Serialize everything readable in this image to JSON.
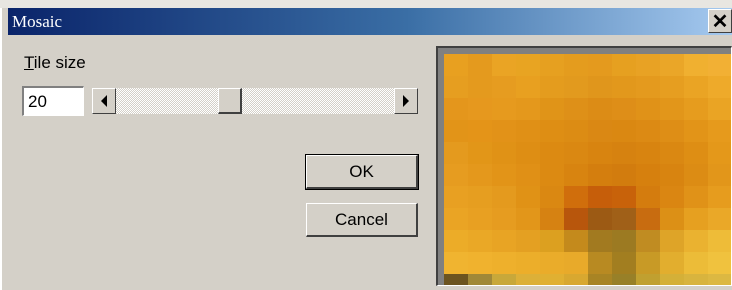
{
  "window": {
    "title": "Mosaic",
    "close_glyph": "✕"
  },
  "tile_size": {
    "label_mnemonic": "T",
    "label_rest": "ile size",
    "value": "20",
    "slider_fraction": 0.4
  },
  "buttons": {
    "ok": "OK",
    "cancel": "Cancel"
  },
  "preview": {
    "tiles": [
      [
        "#e8a020",
        "#e49a1e",
        "#eaa424",
        "#e8a422",
        "#e6a020",
        "#e49c1e",
        "#e49a1e",
        "#e6a020",
        "#e8a224",
        "#eaa628",
        "#f0b030",
        "#f2b034"
      ],
      [
        "#e69e20",
        "#e49a1e",
        "#e69c20",
        "#e8a020",
        "#e49c1e",
        "#e29a1e",
        "#e0961c",
        "#e2981c",
        "#e49a1e",
        "#e69e20",
        "#eaa424",
        "#eeaa2a"
      ],
      [
        "#e4961c",
        "#e6981e",
        "#e69a1e",
        "#e4981c",
        "#e09418",
        "#de9018",
        "#dc8c16",
        "#de8e18",
        "#e09218",
        "#e2961a",
        "#e69c1e",
        "#eaa424"
      ],
      [
        "#e29418",
        "#e49418",
        "#e29218",
        "#e09016",
        "#de8e14",
        "#dc8c14",
        "#da8814",
        "#da8812",
        "#dc8a14",
        "#de8e16",
        "#e29418",
        "#e69a1c"
      ],
      [
        "#e49a1e",
        "#e29618",
        "#e09216",
        "#de8e14",
        "#dc8a12",
        "#da8812",
        "#d88410",
        "#d68210",
        "#d88410",
        "#da8812",
        "#de8e14",
        "#e4981a"
      ],
      [
        "#e69c20",
        "#e4981c",
        "#e29418",
        "#e09016",
        "#dc8a12",
        "#d88410",
        "#d47e0e",
        "#d27c0e",
        "#d6800e",
        "#d88410",
        "#dc8c14",
        "#e2961a"
      ],
      [
        "#e8a022",
        "#e69e20",
        "#e49a1e",
        "#e09216",
        "#da8812",
        "#d06e0c",
        "#c65e0a",
        "#c8620a",
        "#d47c0e",
        "#da8612",
        "#e09218",
        "#e69c1e"
      ],
      [
        "#eaa424",
        "#e8a022",
        "#e69c20",
        "#e2961a",
        "#d68212",
        "#b8560c",
        "#9c5a14",
        "#a06018",
        "#c86c10",
        "#dc9016",
        "#e6a020",
        "#eaa828"
      ],
      [
        "#ecac28",
        "#eaa826",
        "#e8a424",
        "#e4a022",
        "#dca020",
        "#c48a1c",
        "#a27a20",
        "#9c7a22",
        "#c08c22",
        "#dea428",
        "#eab230",
        "#eebc38"
      ],
      [
        "#f0b430",
        "#f0b22e",
        "#eeb02c",
        "#ecae2a",
        "#eaac2a",
        "#e8aa2a",
        "#b88a22",
        "#a27e20",
        "#c89a26",
        "#e2ae2e",
        "#ecbc38",
        "#f0c23e"
      ],
      [
        "#6c5420",
        "#a08838",
        "#c8a83a",
        "#dcb038",
        "#e0b032",
        "#d8a830",
        "#a88424",
        "#988028",
        "#c0a030",
        "#d4b038",
        "#d8b43e",
        "#dcb842"
      ]
    ]
  }
}
